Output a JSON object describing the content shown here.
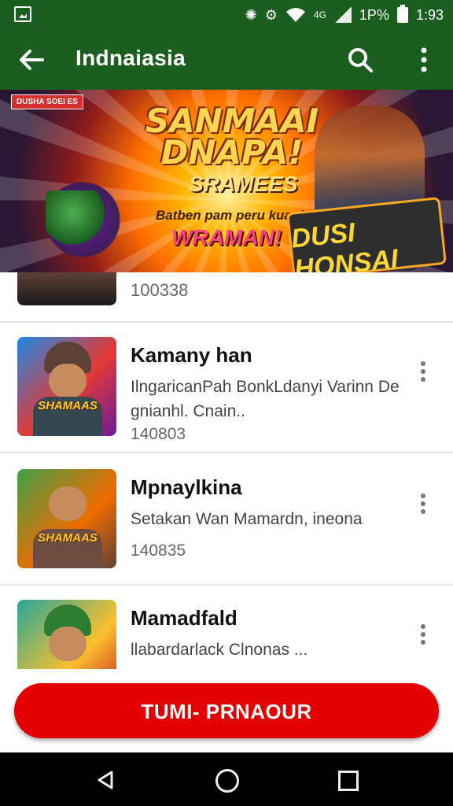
{
  "status_bar": {
    "battery_text": "1P%",
    "time": "1:93",
    "network_text": "4G"
  },
  "app_bar": {
    "title": "Indnaiasia"
  },
  "banner": {
    "tag": "DUSHA SOEI ES",
    "headline": "SANMAAI DNAPA!",
    "headline2": "SRAMEES",
    "subline": "Batben pam peru kuania",
    "cta": "WRAMAN!",
    "badge": "DUSI HONSAI"
  },
  "list": {
    "partial_item": {
      "count": "100338"
    },
    "items": [
      {
        "name": "Kamany han",
        "description": "IlngaricanPah BonkLdanyi Varinn De gnianhl. Cnain..",
        "count": "140803",
        "thumb_label": "SHAMAAS"
      },
      {
        "name": "Mpnaylkina",
        "description": "Setakan Wan Mamardn, ineona",
        "count": "140835",
        "thumb_label": "SHAMAAS"
      },
      {
        "name": "Mamadfald",
        "description": "llabardarlack Clnonas ...",
        "count": "",
        "thumb_label": ""
      }
    ]
  },
  "cta_button": {
    "label": "TUMI- PRNAOUR"
  },
  "colors": {
    "app_bar": "#1b5e20",
    "cta": "#e50000",
    "nav": "#000000"
  }
}
